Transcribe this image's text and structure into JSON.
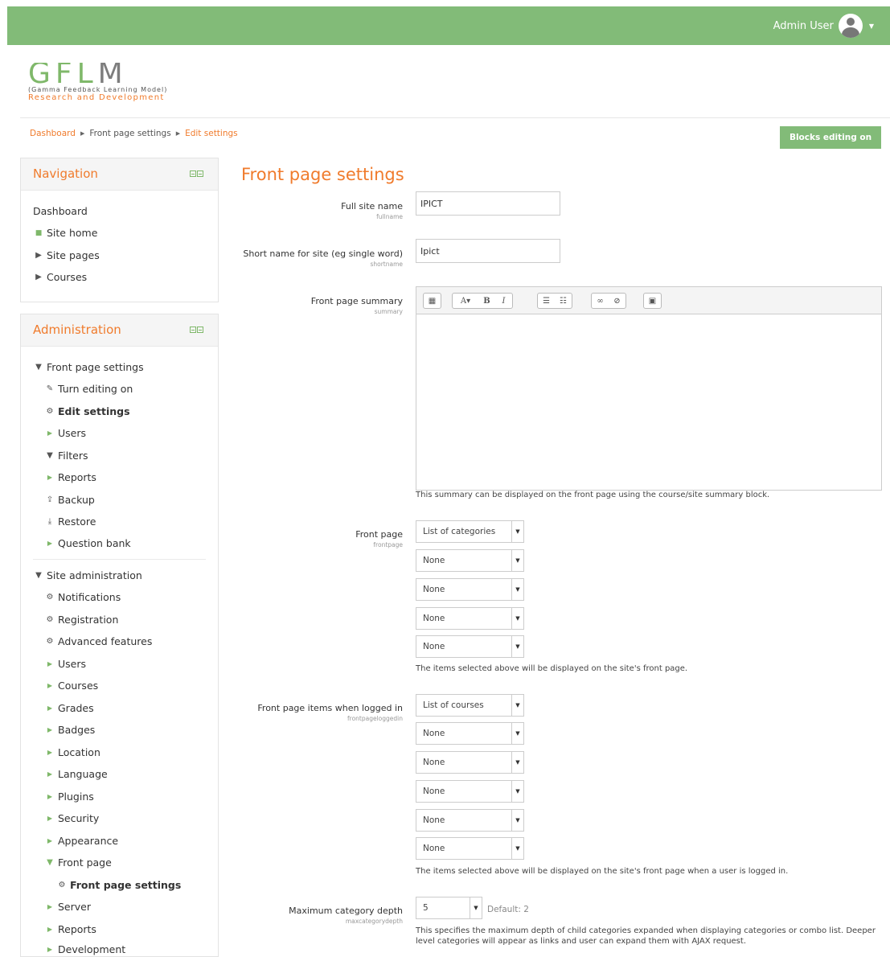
{
  "header": {
    "user_name": "Admin User"
  },
  "logo": {
    "text_g": "GFL",
    "text_m": "M",
    "tagline": "(Gamma Feedback Learning Model)",
    "subtitle": "Research and Development"
  },
  "breadcrumb": {
    "items": [
      "Dashboard",
      "Front page settings",
      "Edit settings"
    ]
  },
  "blocks_editing_label": "Blocks editing on",
  "navigation": {
    "title": "Navigation",
    "items": [
      "Dashboard",
      "Site home",
      "Site pages",
      "Courses"
    ]
  },
  "administration": {
    "title": "Administration",
    "items": [
      "Front page settings",
      "Turn editing on",
      "Edit settings",
      "Users",
      "Filters",
      "Reports",
      "Backup",
      "Restore",
      "Question bank",
      "Site administration",
      "Notifications",
      "Registration",
      "Advanced features",
      "Users",
      "Courses",
      "Grades",
      "Badges",
      "Location",
      "Language",
      "Plugins",
      "Security",
      "Appearance",
      "Front page",
      "Front page settings",
      "Server",
      "Reports",
      "Development"
    ]
  },
  "form": {
    "title": "Front page settings",
    "fullname": {
      "label": "Full site name",
      "sub": "fullname",
      "value": "IPICT"
    },
    "shortname": {
      "label": "Short name for site (eg single word)",
      "sub": "shortname",
      "value": "Ipict"
    },
    "summary": {
      "label": "Front page summary",
      "sub": "summary",
      "help": "This summary can be displayed on the front page using the course/site summary block."
    },
    "frontpage": {
      "label": "Front page",
      "sub": "frontpage",
      "values": [
        "List of categories",
        "None",
        "None",
        "None",
        "None"
      ],
      "help": "The items selected above will be displayed on the site's front page."
    },
    "frontpageloggedin": {
      "label": "Front page items when logged in",
      "sub": "frontpageloggedin",
      "values": [
        "List of courses",
        "None",
        "None",
        "None",
        "None",
        "None"
      ],
      "help": "The items selected above will be displayed on the site's front page when a user is logged in."
    },
    "maxcategorydepth": {
      "label": "Maximum category depth",
      "sub": "maxcategorydepth",
      "value": "5",
      "default": "Default: 2",
      "help": "This specifies the maximum depth of child categories expanded when displaying categories or combo list. Deeper level categories will appear as links and user can expand them with AJAX request."
    }
  }
}
